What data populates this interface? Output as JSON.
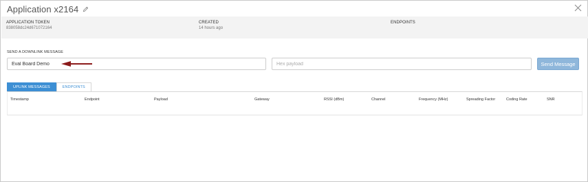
{
  "header": {
    "title": "Application x2164",
    "edit_icon": "pencil-icon",
    "close_icon": "close-icon"
  },
  "info": {
    "token_label": "APPLICATION TOKEN",
    "token_value": "838058dc24d671072164",
    "created_label": "CREATED",
    "created_value": "14 hours ago",
    "endpoints_label": "ENDPOINTS"
  },
  "downlink": {
    "label": "SEND A DOWNLINK MESSAGE",
    "endpoint_value": "Eval Board Demo",
    "payload_placeholder": "Hex payload",
    "send_label": "Send Message",
    "arrow_color": "#8b1a1a"
  },
  "tabs": [
    {
      "label": "UPLINK MESSAGES",
      "active": true
    },
    {
      "label": "ENDPOINTS",
      "active": false
    }
  ],
  "table": {
    "columns": [
      "Timestamp",
      "Endpoint",
      "Payload",
      "Gateway",
      "RSSI (dBm)",
      "Channel",
      "Frequency (MHz)",
      "Spreading Factor",
      "Coding Rate",
      "SNR"
    ],
    "rows": []
  },
  "colors": {
    "accent": "#3d8fd4",
    "send_button": "#8fb7db",
    "info_band": "#f3f3f3"
  }
}
